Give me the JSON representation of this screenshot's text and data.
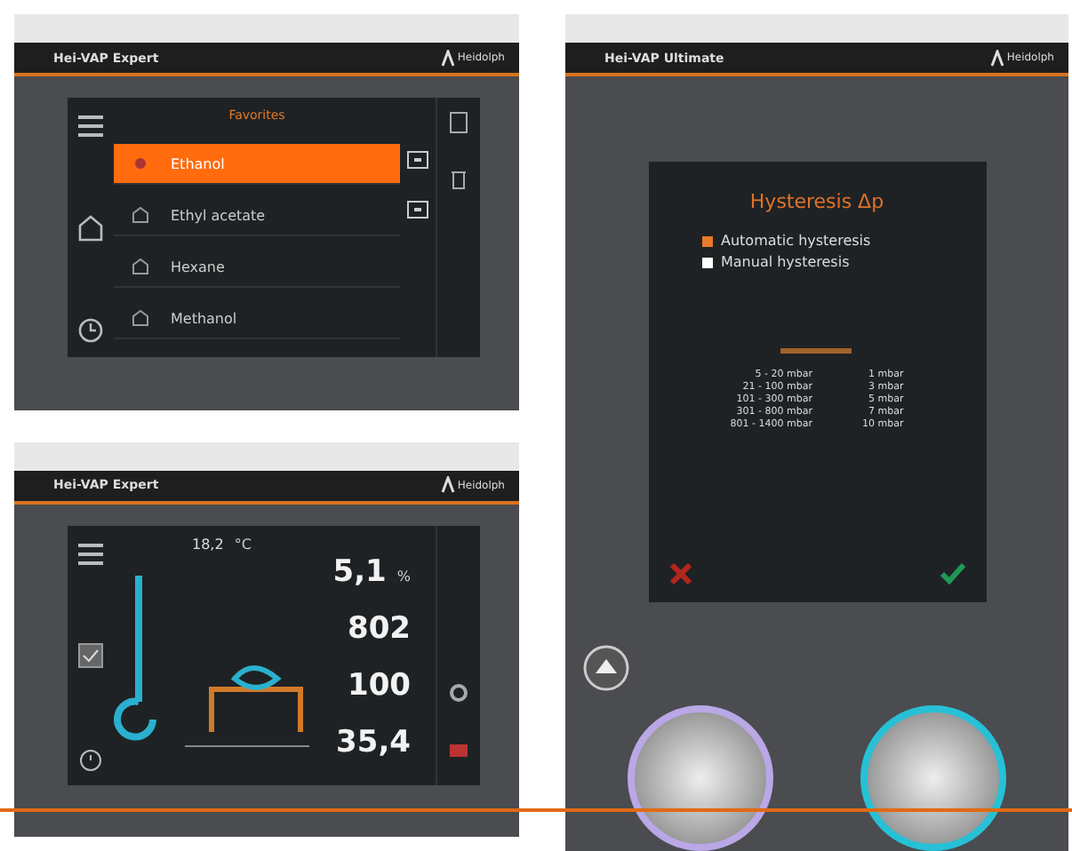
{
  "panels": [
    {
      "kind": "favorites",
      "header": {
        "title": "Hei-VAP Expert",
        "logo": "Heidolph"
      },
      "screen": {
        "title": "Favorites",
        "items": [
          {
            "label": "Ethanol",
            "selected": true
          },
          {
            "label": "Ethyl acetate",
            "selected": false
          },
          {
            "label": "Hexane",
            "selected": false
          },
          {
            "label": "Methanol",
            "selected": false
          }
        ]
      }
    },
    {
      "kind": "dashboard",
      "header": {
        "title": "Hei-VAP Expert",
        "logo": "Heidolph"
      },
      "screen": {
        "small_reading": "18,2",
        "small_unit": "°C",
        "readings": [
          {
            "value": "5,1",
            "unit": "%"
          },
          {
            "value": "802"
          },
          {
            "value": "100"
          },
          {
            "value": "35,4"
          }
        ]
      }
    },
    {
      "kind": "hysteresis",
      "header": {
        "title": "Hei-VAP Ultimate",
        "logo": "Heidolph"
      },
      "screen": {
        "title": "Hysteresis Δp",
        "options": [
          {
            "label": "Automatic hysteresis",
            "selected": true
          },
          {
            "label": "Manual hysteresis",
            "selected": false
          }
        ],
        "rows": [
          {
            "range": "5 - 20 mbar",
            "step": "1 mbar"
          },
          {
            "range": "21 - 100 mbar",
            "step": "3 mbar"
          },
          {
            "range": "101 - 300 mbar",
            "step": "5 mbar"
          },
          {
            "range": "301 - 800 mbar",
            "step": "7 mbar"
          },
          {
            "range": "801 - 1400 mbar",
            "step": "10 mbar"
          }
        ]
      }
    }
  ]
}
